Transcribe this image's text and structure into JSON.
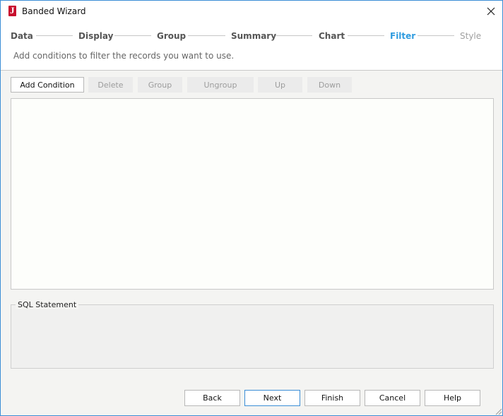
{
  "window": {
    "title": "Banded Wizard"
  },
  "steps": [
    {
      "label": "Data",
      "state": "done"
    },
    {
      "label": "Display",
      "state": "done"
    },
    {
      "label": "Group",
      "state": "done"
    },
    {
      "label": "Summary",
      "state": "done"
    },
    {
      "label": "Chart",
      "state": "done"
    },
    {
      "label": "Filter",
      "state": "active"
    },
    {
      "label": "Style",
      "state": "disabled"
    }
  ],
  "subtitle": "Add conditions to filter the records you want to use.",
  "toolbar": {
    "add_condition": "Add Condition",
    "delete": "Delete",
    "group": "Group",
    "ungroup": "Ungroup",
    "up": "Up",
    "down": "Down"
  },
  "sql": {
    "label": "SQL Statement",
    "value": ""
  },
  "footer": {
    "back": "Back",
    "next": "Next",
    "finish": "Finish",
    "cancel": "Cancel",
    "help": "Help"
  },
  "colors": {
    "active_step": "#2e9bdf",
    "window_border": "#3c8ed6",
    "app_icon": "#c8102e"
  },
  "icons": {
    "app": "jreport-logo-icon",
    "close": "close-icon",
    "resize": "resize-grip-icon"
  }
}
